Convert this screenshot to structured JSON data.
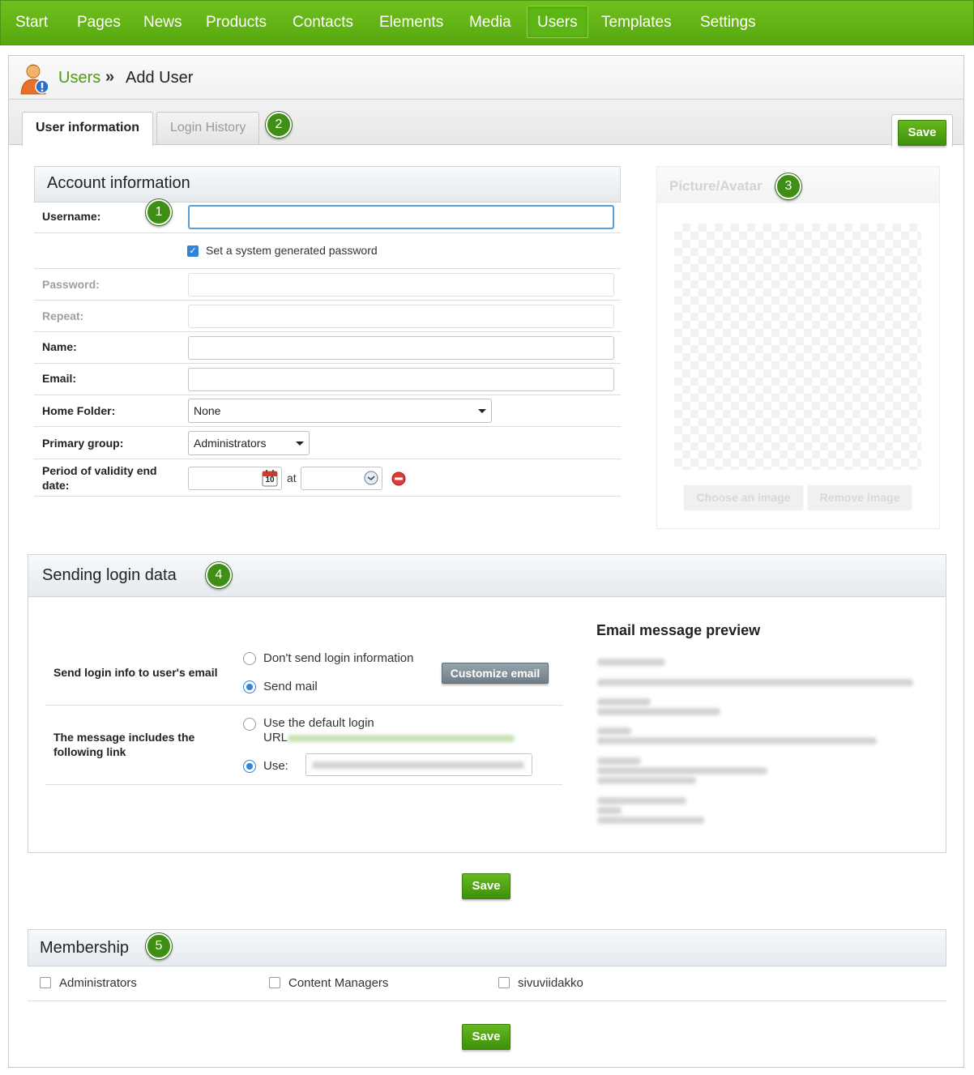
{
  "nav": {
    "items": [
      "Start",
      "Pages",
      "News",
      "Products",
      "Contacts",
      "Elements",
      "Media",
      "Users",
      "Templates",
      "Settings"
    ],
    "active": "Users"
  },
  "breadcrumb": {
    "parent": "Users",
    "separator": "»",
    "current": "Add User"
  },
  "tabs": {
    "user_info": "User information",
    "login_history": "Login History"
  },
  "buttons": {
    "save": "Save",
    "customize_email": "Customize email",
    "choose_image": "Choose an image",
    "remove_image": "Remove image"
  },
  "badges": [
    "1",
    "2",
    "3",
    "4",
    "5"
  ],
  "account": {
    "title": "Account information",
    "username_label": "Username:",
    "system_password_label": "Set a system generated password",
    "password_label": "Password:",
    "repeat_label": "Repeat:",
    "name_label": "Name:",
    "email_label": "Email:",
    "home_folder_label": "Home Folder:",
    "home_folder_value": "None",
    "primary_group_label": "Primary group:",
    "primary_group_value": "Administrators",
    "validity_label": "Period of validity end date:",
    "at_label": "at",
    "calendar_day": "10"
  },
  "avatar": {
    "title": "Picture/Avatar"
  },
  "sending": {
    "title": "Sending login data",
    "send_info_label": "Send login info to user's email",
    "dont_send": "Don't send login information",
    "send_mail": "Send mail",
    "link_label": "The message includes the following link",
    "default_login": "Use the default login",
    "url_prefix": "URL",
    "use_label": "Use:",
    "preview_title": "Email message preview"
  },
  "membership": {
    "title": "Membership",
    "groups": [
      "Administrators",
      "Content Managers",
      "sivuviidakko"
    ]
  },
  "colors": {
    "brand_green": "#5cb514",
    "accent_blue": "#2f84d8"
  }
}
